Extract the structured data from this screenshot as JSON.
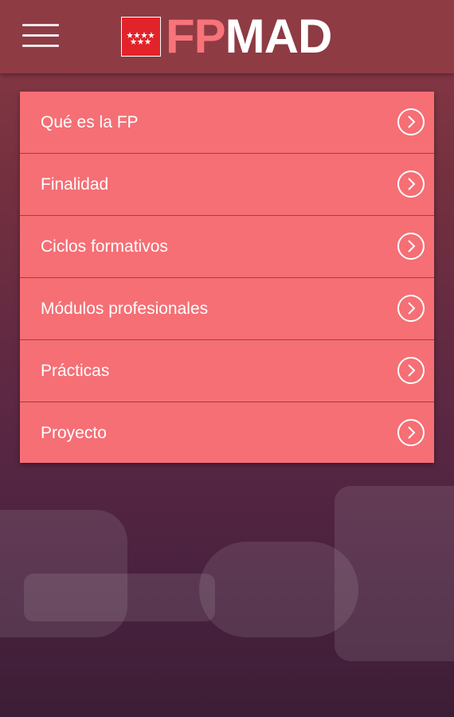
{
  "header": {
    "menu_icon": "hamburger-menu-icon",
    "logo": {
      "part1": "FP",
      "part2": "MAD",
      "flag_icon": "madrid-flag-icon"
    }
  },
  "menu": {
    "items": [
      {
        "label": "Qué es la FP",
        "icon": "chevron-right-circle-icon"
      },
      {
        "label": "Finalidad",
        "icon": "chevron-right-circle-icon"
      },
      {
        "label": "Ciclos formativos",
        "icon": "chevron-right-circle-icon"
      },
      {
        "label": "Módulos profesionales",
        "icon": "chevron-right-circle-icon"
      },
      {
        "label": "Prácticas",
        "icon": "chevron-right-circle-icon"
      },
      {
        "label": "Proyecto",
        "icon": "chevron-right-circle-icon"
      }
    ]
  },
  "colors": {
    "header_bg": "#8e3b44",
    "menu_item_bg": "#f56f75",
    "logo_fp": "#f7747a",
    "logo_mad": "#ffffff",
    "flag_red": "#e2232a"
  }
}
